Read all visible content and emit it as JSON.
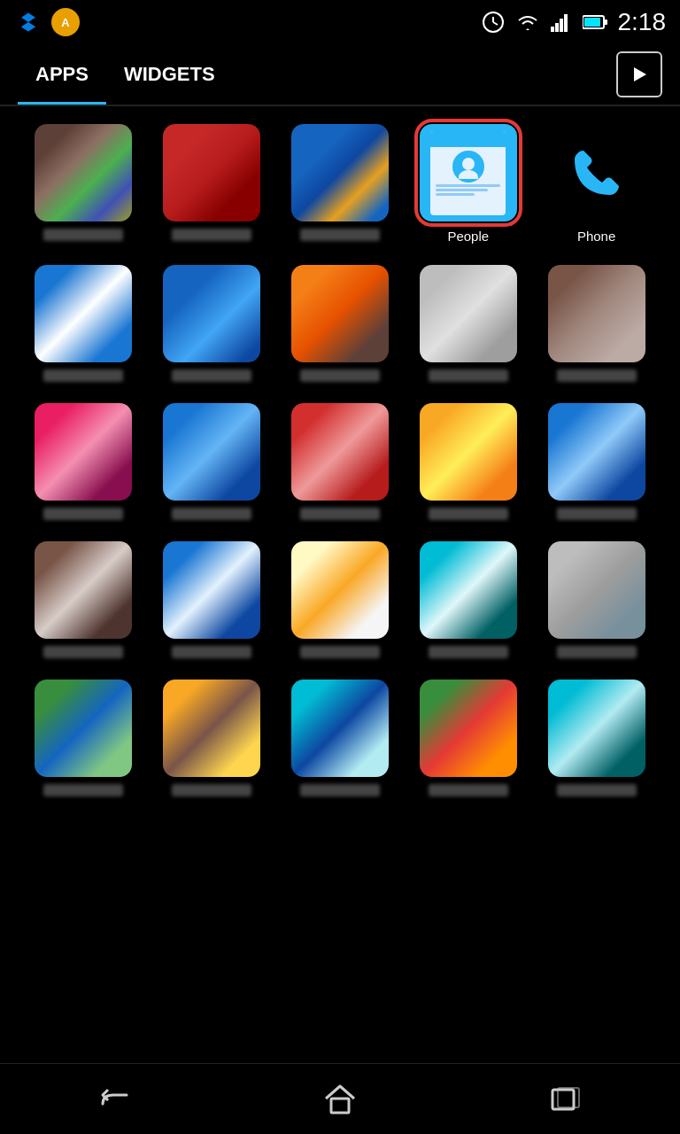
{
  "status": {
    "time": "2:18",
    "icons": [
      "clock",
      "wifi",
      "signal",
      "battery"
    ]
  },
  "tabs": [
    {
      "label": "APPS",
      "active": true
    },
    {
      "label": "WIDGETS",
      "active": false
    }
  ],
  "store_button": "▶",
  "apps": [
    {
      "id": 1,
      "label": "",
      "icon_class": "icon-1",
      "highlighted": false
    },
    {
      "id": 2,
      "label": "",
      "icon_class": "icon-2",
      "highlighted": false
    },
    {
      "id": 3,
      "label": "",
      "icon_class": "icon-3",
      "highlighted": false
    },
    {
      "id": 4,
      "label": "People",
      "icon_class": "people-icon",
      "highlighted": true
    },
    {
      "id": 5,
      "label": "Phone",
      "icon_class": "icon-phone",
      "highlighted": false
    },
    {
      "id": 6,
      "label": "",
      "icon_class": "icon-5",
      "highlighted": false
    },
    {
      "id": 7,
      "label": "",
      "icon_class": "icon-6",
      "highlighted": false
    },
    {
      "id": 8,
      "label": "",
      "icon_class": "icon-7",
      "highlighted": false
    },
    {
      "id": 9,
      "label": "",
      "icon_class": "icon-8",
      "highlighted": false
    },
    {
      "id": 10,
      "label": "",
      "icon_class": "icon-9",
      "highlighted": false
    },
    {
      "id": 11,
      "label": "",
      "icon_class": "icon-10",
      "highlighted": false
    },
    {
      "id": 12,
      "label": "",
      "icon_class": "icon-11",
      "highlighted": false
    },
    {
      "id": 13,
      "label": "",
      "icon_class": "icon-12",
      "highlighted": false
    },
    {
      "id": 14,
      "label": "",
      "icon_class": "icon-13",
      "highlighted": false
    },
    {
      "id": 15,
      "label": "",
      "icon_class": "icon-14",
      "highlighted": false
    },
    {
      "id": 16,
      "label": "",
      "icon_class": "icon-15",
      "highlighted": false
    },
    {
      "id": 17,
      "label": "",
      "icon_class": "icon-16",
      "highlighted": false
    },
    {
      "id": 18,
      "label": "",
      "icon_class": "icon-17",
      "highlighted": false
    },
    {
      "id": 19,
      "label": "",
      "icon_class": "icon-18",
      "highlighted": false
    },
    {
      "id": 20,
      "label": "",
      "icon_class": "icon-19",
      "highlighted": false
    },
    {
      "id": 21,
      "label": "",
      "icon_class": "icon-20",
      "highlighted": false
    },
    {
      "id": 22,
      "label": "",
      "icon_class": "icon-21",
      "highlighted": false
    },
    {
      "id": 23,
      "label": "",
      "icon_class": "icon-22",
      "highlighted": false
    },
    {
      "id": 24,
      "label": "",
      "icon_class": "icon-23",
      "highlighted": false
    },
    {
      "id": 25,
      "label": "",
      "icon_class": "icon-24",
      "highlighted": false
    }
  ],
  "nav": {
    "back": "↩",
    "home": "⌂",
    "recents": "▭"
  }
}
